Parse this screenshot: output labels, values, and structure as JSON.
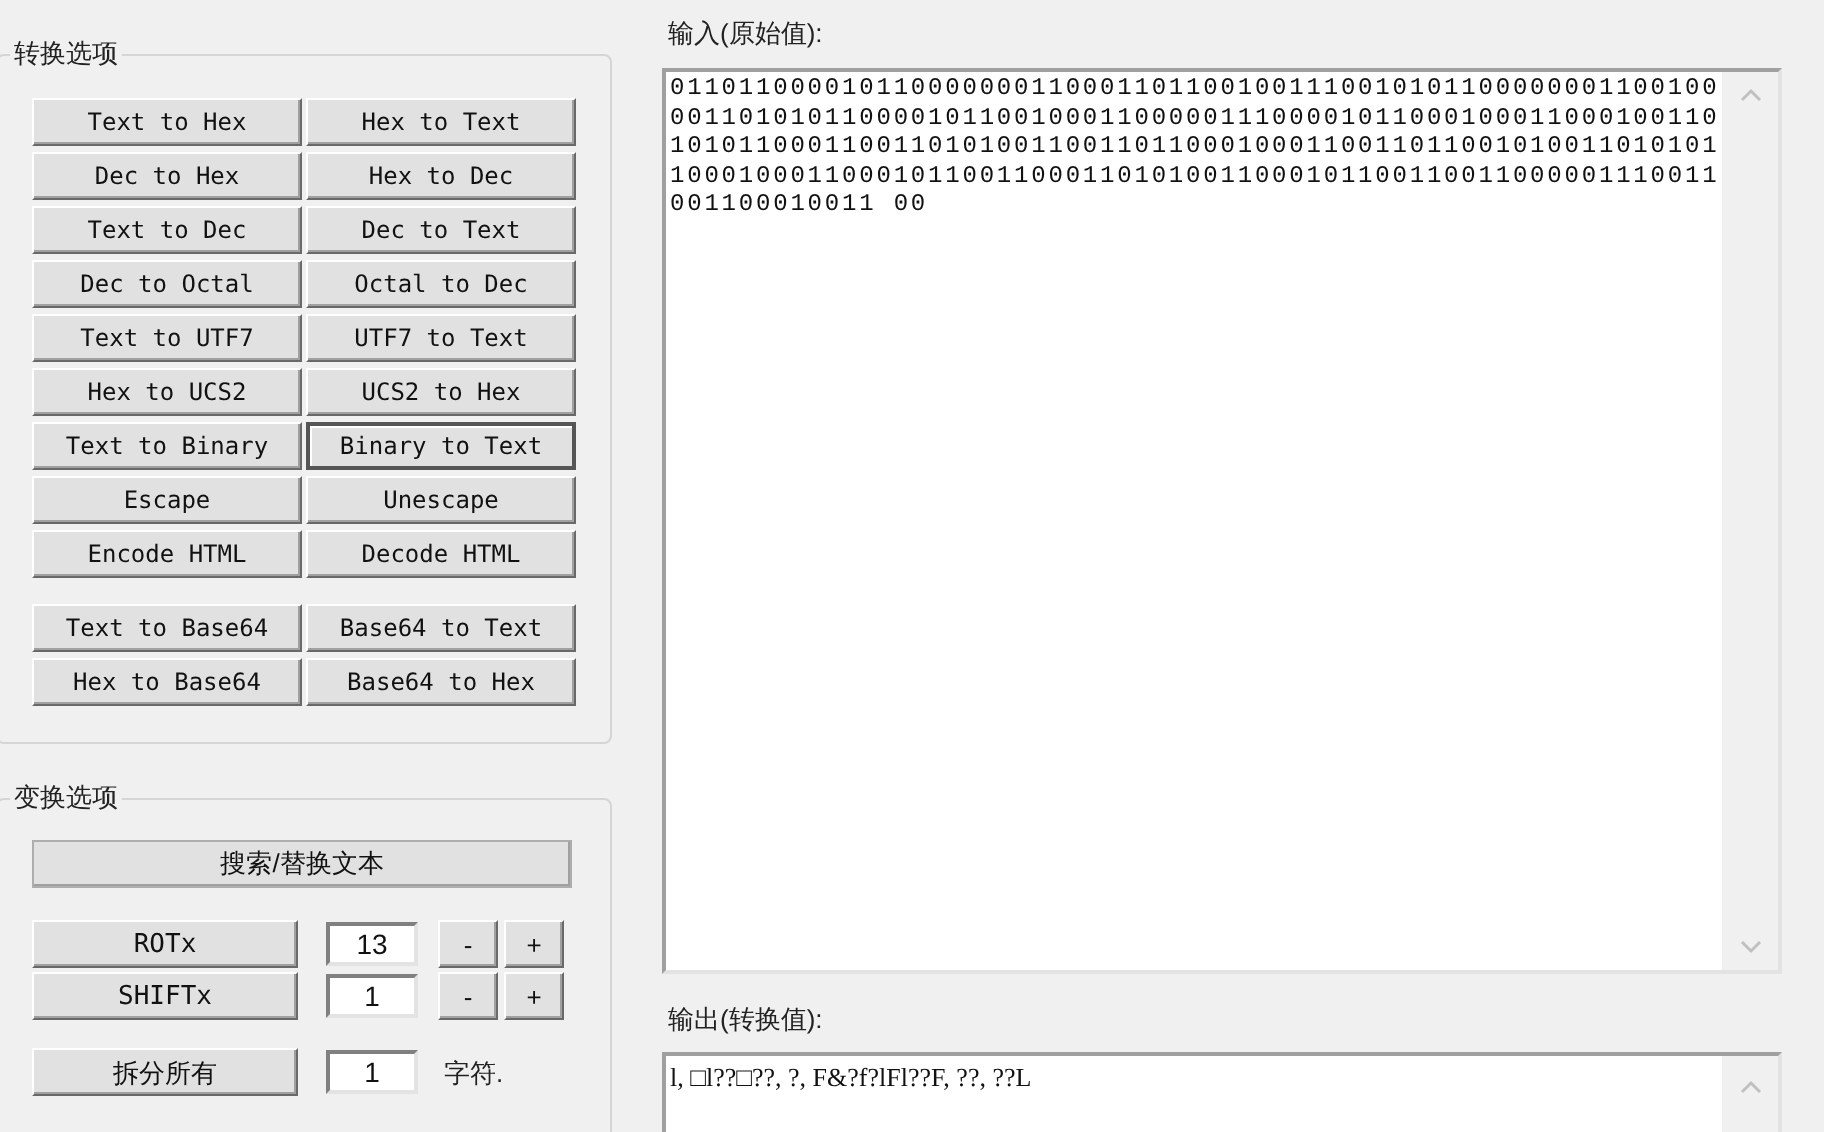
{
  "conversion_group": {
    "title": "转换选项",
    "buttons": [
      {
        "label": "Text to Hex",
        "focused": false
      },
      {
        "label": "Hex to Text",
        "focused": false
      },
      {
        "label": "Dec to Hex",
        "focused": false
      },
      {
        "label": "Hex to Dec",
        "focused": false
      },
      {
        "label": "Text to Dec",
        "focused": false
      },
      {
        "label": "Dec to Text",
        "focused": false
      },
      {
        "label": "Dec to Octal",
        "focused": false
      },
      {
        "label": "Octal to Dec",
        "focused": false
      },
      {
        "label": "Text to UTF7",
        "focused": false
      },
      {
        "label": "UTF7 to Text",
        "focused": false
      },
      {
        "label": "Hex to UCS2",
        "focused": false
      },
      {
        "label": "UCS2 to Hex",
        "focused": false
      },
      {
        "label": "Text to Binary",
        "focused": false
      },
      {
        "label": "Binary to Text",
        "focused": true
      },
      {
        "label": "Escape",
        "focused": false
      },
      {
        "label": "Unescape",
        "focused": false
      },
      {
        "label": "Encode HTML",
        "focused": false
      },
      {
        "label": "Decode HTML",
        "focused": false
      },
      {
        "label": "Text to Base64",
        "focused": false
      },
      {
        "label": "Base64 to Text",
        "focused": false
      },
      {
        "label": "Hex to Base64",
        "focused": false
      },
      {
        "label": "Base64 to Hex",
        "focused": false
      }
    ]
  },
  "transform_group": {
    "title": "变换选项",
    "search_replace": "搜索/替换文本",
    "rows": [
      {
        "label": "ROTx",
        "value": "13",
        "minus": "-",
        "plus": "+"
      },
      {
        "label": "SHIFTx",
        "value": "1",
        "minus": "-",
        "plus": "+"
      }
    ],
    "split": {
      "label": "拆分所有",
      "value": "1",
      "unit": "字符."
    }
  },
  "input": {
    "label": "输入(原始值):",
    "value": "0110110000101100000001100011011001001110010101100000001100100001101010110000101100100011000001110000101100010001100010011010101100011001101010011001101100010001100110110010100110101011000100011000101100110001101010011000101100110011000001110011001100010011 00"
  },
  "output": {
    "label": "输出(转换值):",
    "value": "l, □l??□??, ?, F&?f?lFl??F, ??, ??L"
  }
}
